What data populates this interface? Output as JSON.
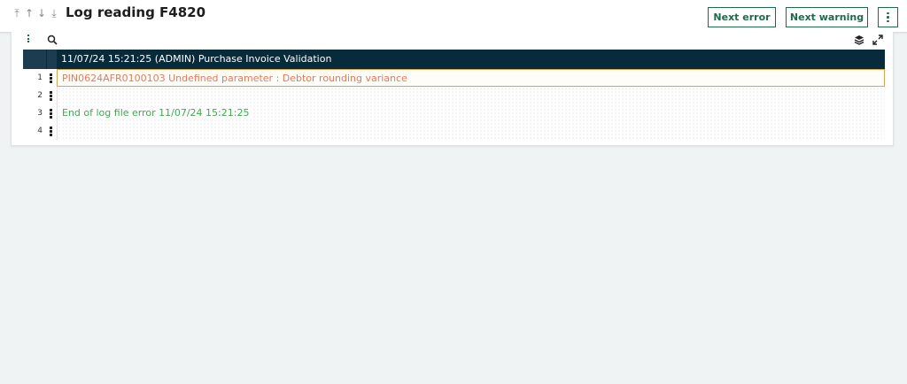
{
  "header": {
    "title": "Log reading F4820",
    "nav": [
      {
        "name": "first-record-icon",
        "glyph": "⤒"
      },
      {
        "name": "previous-record-icon",
        "glyph": "↑"
      },
      {
        "name": "next-record-icon",
        "glyph": "↓"
      },
      {
        "name": "last-record-icon",
        "glyph": "⤓"
      }
    ],
    "next_error_label": "Next error",
    "next_warning_label": "Next warning",
    "more_icon": "vertical-ellipsis-icon"
  },
  "toolbar": {
    "icons": [
      "grid-menu-icon",
      "search-icon",
      "layers-icon",
      "expand-icon"
    ]
  },
  "log": {
    "header_text": "11/07/24 15:21:25 (ADMIN) Purchase Invoice Validation",
    "rows": [
      {
        "num": "1",
        "text": "PIN0624AFR0100103 Undefined parameter : Debtor rounding variance",
        "status": "error"
      },
      {
        "num": "2",
        "text": "",
        "status": "none"
      },
      {
        "num": "3",
        "text": "End of log file error 11/07/24 15:21:25",
        "status": "success"
      },
      {
        "num": "4",
        "text": "",
        "status": "none"
      }
    ]
  },
  "colors": {
    "accent": "#1e6b4a",
    "header_bg": "#082b3c",
    "error_text": "#e07b5e",
    "error_border": "#d9a451",
    "success_text": "#3ea84e",
    "page_bg": "#f0f3f3"
  }
}
